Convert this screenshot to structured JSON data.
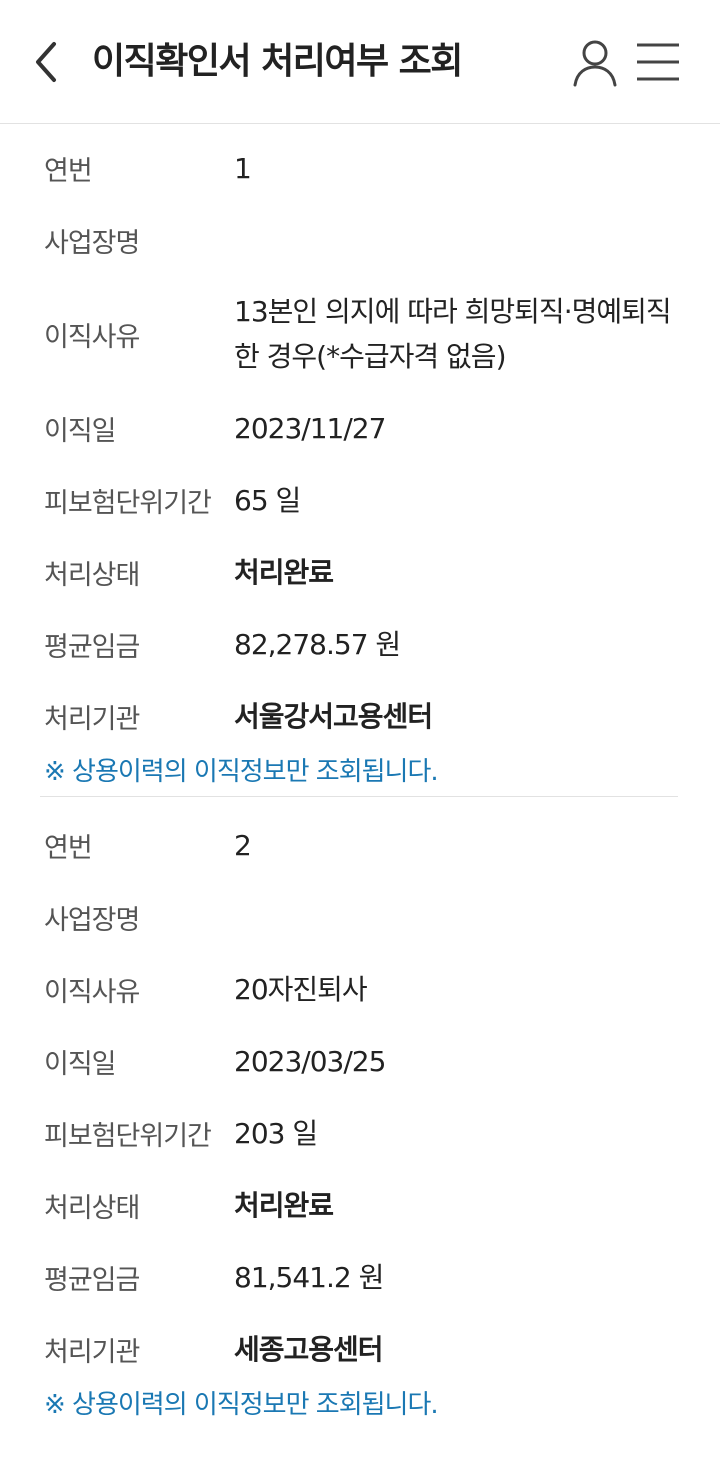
{
  "header": {
    "title": "이직확인서 처리여부 조회"
  },
  "labels": {
    "seq": "연번",
    "workplace": "사업장명",
    "reason": "이직사유",
    "date": "이직일",
    "period": "피보험단위기간",
    "status": "처리상태",
    "wage": "평균임금",
    "office": "처리기관"
  },
  "records": [
    {
      "seq": "1",
      "workplace": "",
      "reason": "13본인 의지에 따라 희망퇴직·명예퇴직한 경우(*수급자격 없음)",
      "date": "2023/11/27",
      "period": "65 일",
      "status": "처리완료",
      "wage": "82,278.57 원",
      "office": "서울강서고용센터",
      "note": "※ 상용이력의 이직정보만 조회됩니다."
    },
    {
      "seq": "2",
      "workplace": "",
      "reason": "20자진퇴사",
      "date": "2023/03/25",
      "period": "203 일",
      "status": "처리완료",
      "wage": "81,541.2 원",
      "office": "세종고용센터",
      "note": "※ 상용이력의 이직정보만 조회됩니다."
    }
  ],
  "icons": {
    "back": "chevron-left-icon",
    "user": "user-icon",
    "menu": "hamburger-menu-icon"
  },
  "colors": {
    "note": "#1a78b3",
    "text": "#222222",
    "label": "#555555",
    "divider": "#e2e2e2"
  }
}
